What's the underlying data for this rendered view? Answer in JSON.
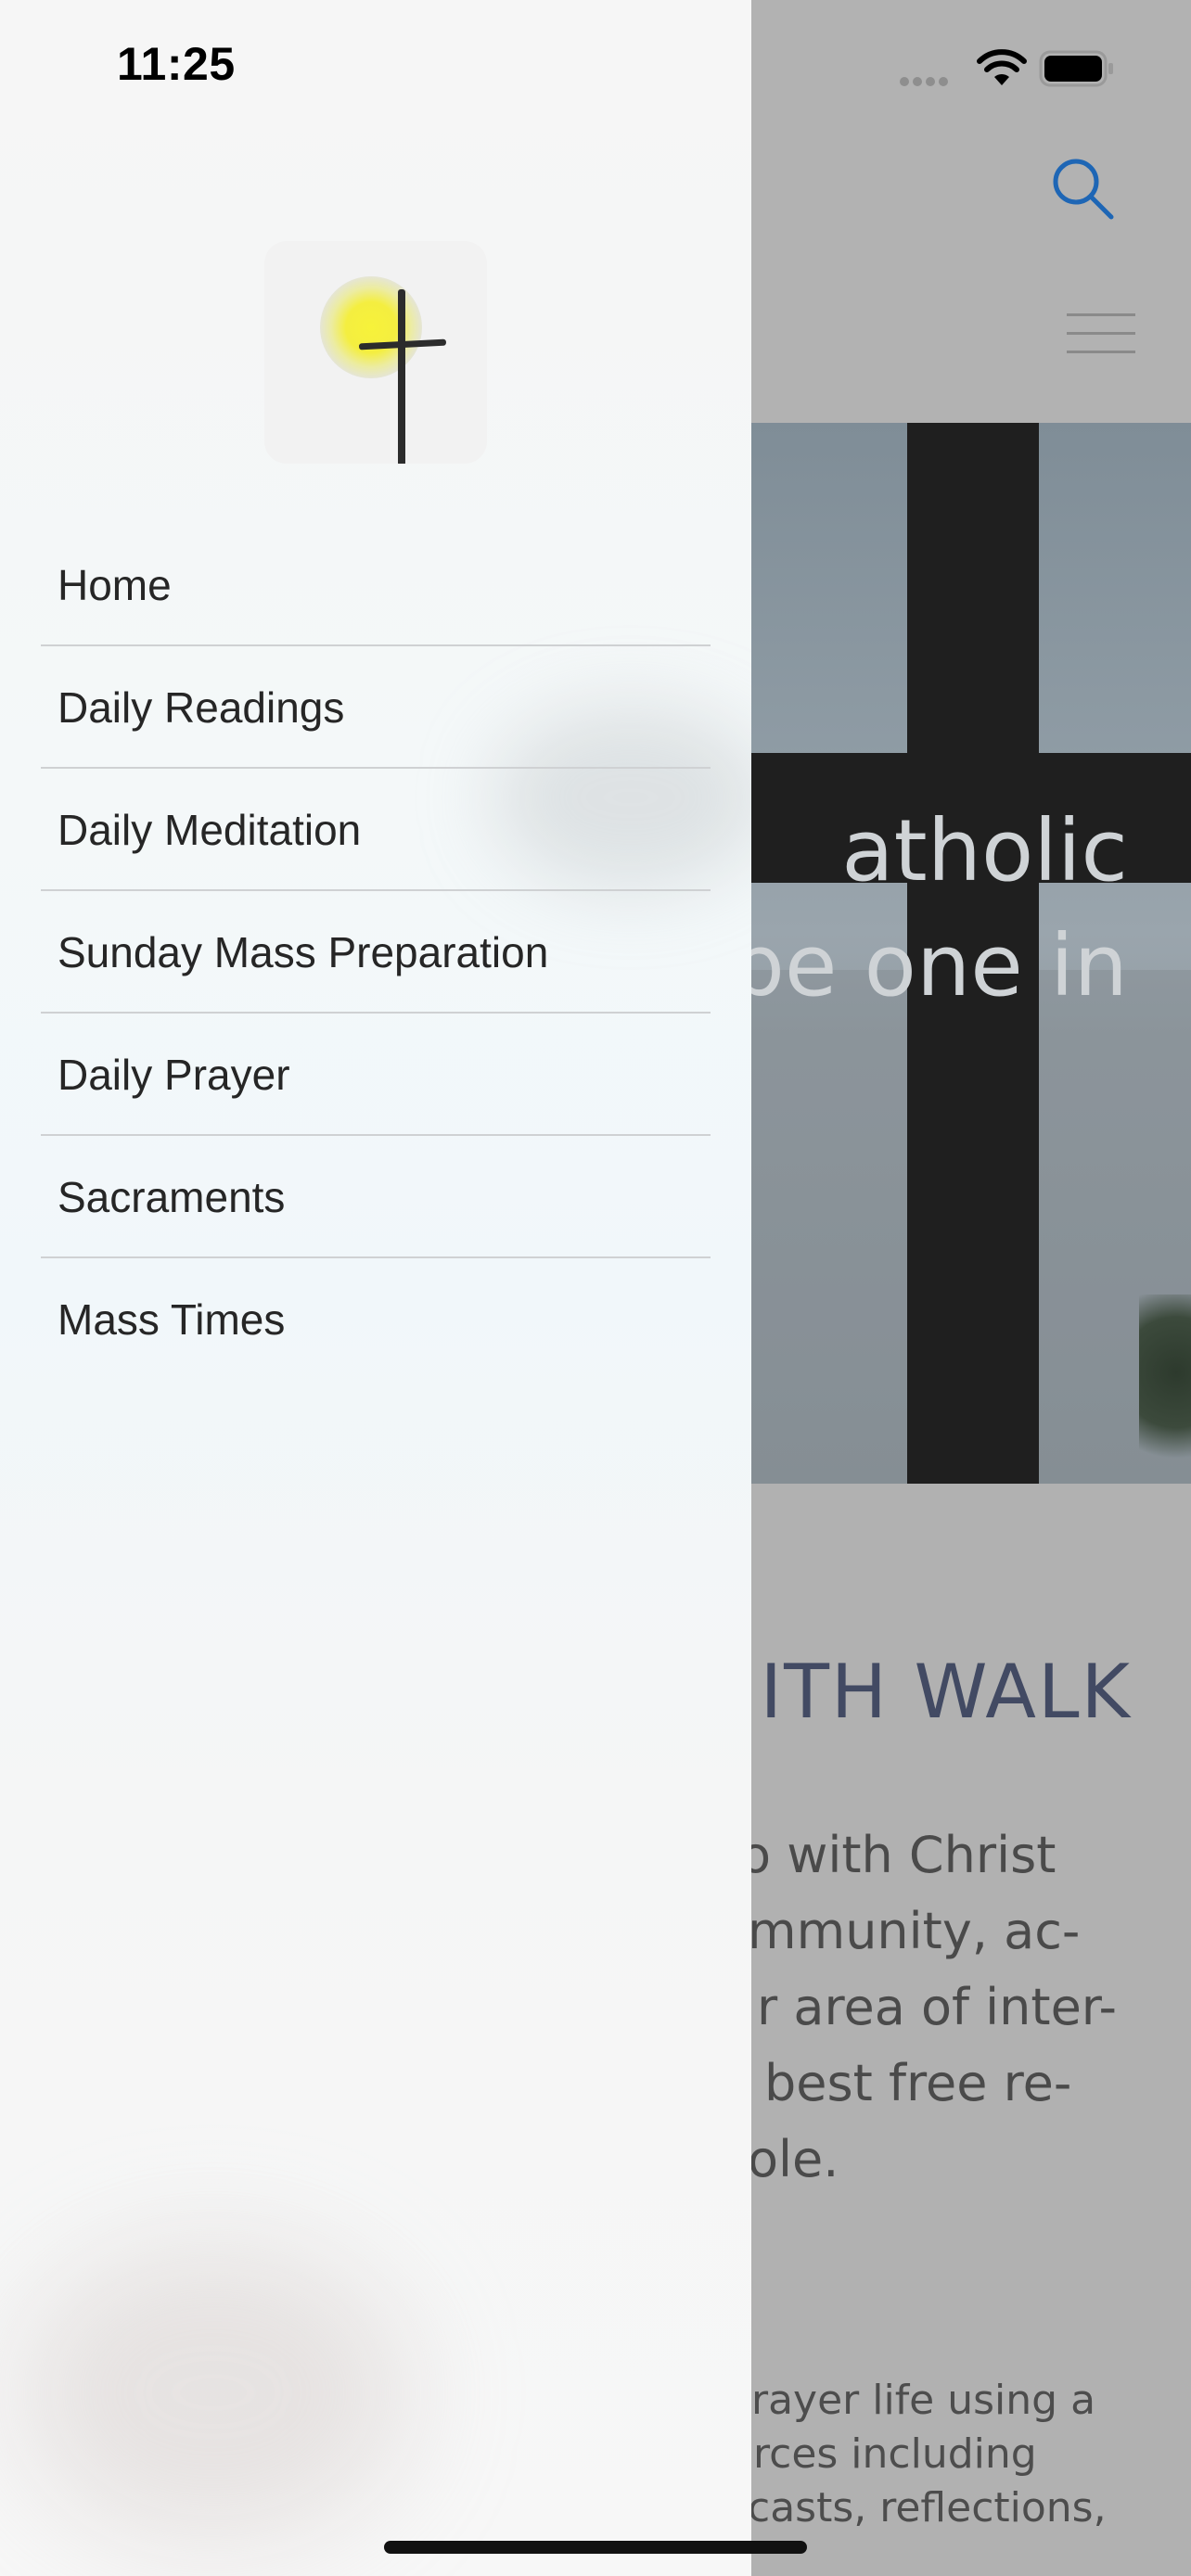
{
  "status_bar": {
    "time": "11:25"
  },
  "hero": {
    "line1": "atholic",
    "line2": "be one in"
  },
  "section": {
    "title": "ITH WALK",
    "body_lines": [
      "o with Christ",
      "mmunity, ac-",
      "r area of inter-",
      "best free re-",
      "ole."
    ],
    "prayer_lines": [
      "rayer life using a",
      "rces including",
      "casts, reflections,"
    ]
  },
  "menu": {
    "items": [
      {
        "label": "Home"
      },
      {
        "label": "Daily Readings"
      },
      {
        "label": "Daily Meditation"
      },
      {
        "label": "Sunday Mass Preparation"
      },
      {
        "label": "Daily Prayer"
      },
      {
        "label": "Sacraments"
      },
      {
        "label": "Mass Times"
      }
    ]
  },
  "colors": {
    "accent": "#1e66b5",
    "title": "#424a63",
    "drawer_bg": "#f6f6f6"
  }
}
